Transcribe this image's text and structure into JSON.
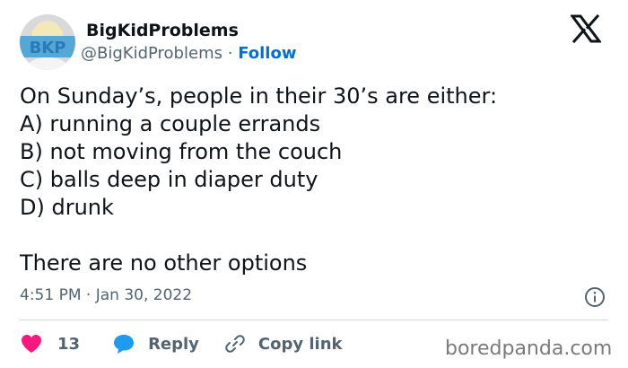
{
  "author": {
    "display_name": "BigKidProblems",
    "handle": "@BigKidProblems",
    "separator": "·",
    "follow_label": "Follow",
    "avatar_text": "BKP"
  },
  "tweet": {
    "lines": [
      "On Sunday’s, people in their 30’s are either:",
      "A) running a couple errands",
      "B) not moving from the couch",
      "C) balls deep in diaper duty",
      "D) drunk",
      "There are no other options"
    ],
    "timestamp": "4:51 PM · Jan 30, 2022"
  },
  "actions": {
    "like_count": "13",
    "reply_label": "Reply",
    "copy_link_label": "Copy link"
  },
  "watermark": "boredpanda.com",
  "colors": {
    "link_blue": "#006fd6",
    "heart_pink": "#f91880",
    "reply_blue": "#1d9bf0",
    "muted_gray": "#536471"
  },
  "icons": [
    "x-logo-icon",
    "info-icon",
    "heart-icon",
    "reply-bubble-icon",
    "link-icon"
  ]
}
